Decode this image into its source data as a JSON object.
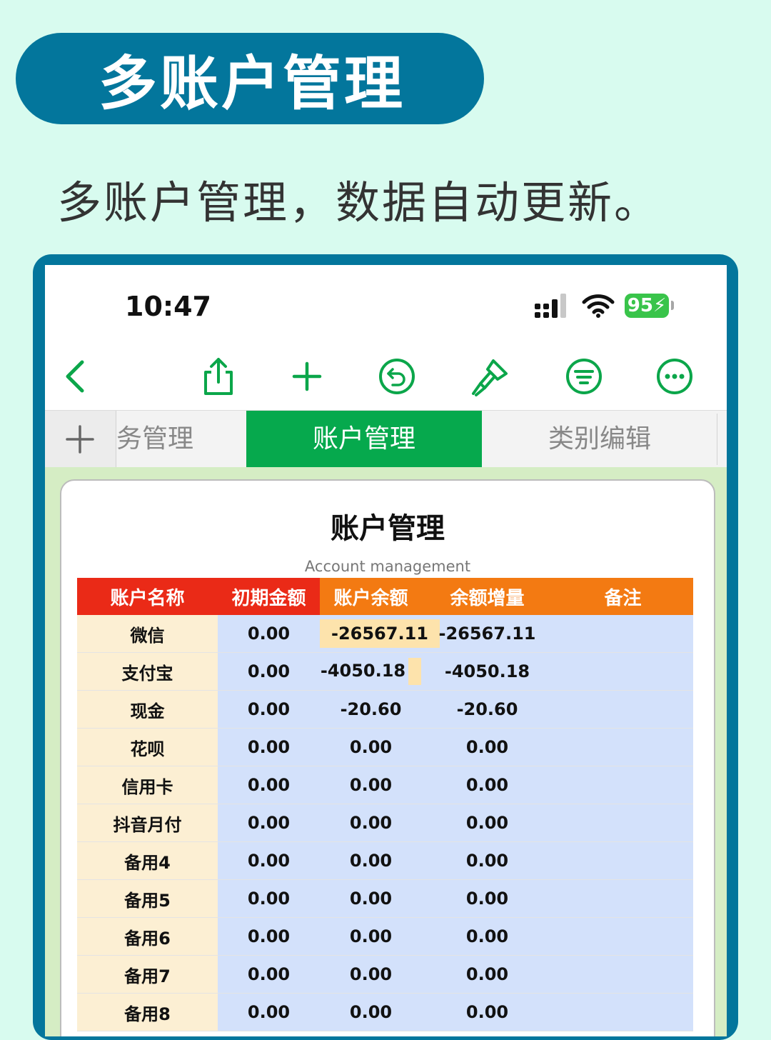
{
  "banner": {
    "title": "多账户管理"
  },
  "subtitle": "多账户管理，数据自动更新。",
  "status_bar": {
    "time": "10:47",
    "battery": "95"
  },
  "toolbar": {
    "icons": [
      "back-chevron-icon",
      "share-icon",
      "add-icon",
      "undo-icon",
      "format-brush-icon",
      "filter-icon",
      "more-icon"
    ]
  },
  "tabs": {
    "add_label": "+",
    "prev_partial": "务管理",
    "active": "账户管理",
    "next": "类别编辑"
  },
  "card": {
    "title": "账户管理",
    "subtitle": "Account management"
  },
  "table": {
    "headers": [
      "账户名称",
      "初期金额",
      "账户余额",
      "余额增量",
      "备注"
    ],
    "rows": [
      {
        "name": "微信",
        "initial": "0.00",
        "balance": "-26567.11",
        "delta": "-26567.11",
        "note": ""
      },
      {
        "name": "支付宝",
        "initial": "0.00",
        "balance": "-4050.18",
        "delta": "-4050.18",
        "note": ""
      },
      {
        "name": "现金",
        "initial": "0.00",
        "balance": "-20.60",
        "delta": "-20.60",
        "note": ""
      },
      {
        "name": "花呗",
        "initial": "0.00",
        "balance": "0.00",
        "delta": "0.00",
        "note": ""
      },
      {
        "name": "信用卡",
        "initial": "0.00",
        "balance": "0.00",
        "delta": "0.00",
        "note": ""
      },
      {
        "name": "抖音月付",
        "initial": "0.00",
        "balance": "0.00",
        "delta": "0.00",
        "note": ""
      },
      {
        "name": "备用4",
        "initial": "0.00",
        "balance": "0.00",
        "delta": "0.00",
        "note": ""
      },
      {
        "name": "备用5",
        "initial": "0.00",
        "balance": "0.00",
        "delta": "0.00",
        "note": ""
      },
      {
        "name": "备用6",
        "initial": "0.00",
        "balance": "0.00",
        "delta": "0.00",
        "note": ""
      },
      {
        "name": "备用7",
        "initial": "0.00",
        "balance": "0.00",
        "delta": "0.00",
        "note": ""
      },
      {
        "name": "备用8",
        "initial": "0.00",
        "balance": "0.00",
        "delta": "0.00",
        "note": ""
      }
    ]
  },
  "colors": {
    "page_bg": "#d8fbef",
    "brand": "#03769c",
    "accent_green": "#06a94d",
    "header_red": "#ea2a17",
    "header_orange": "#f37a12",
    "name_col": "#fcefd3",
    "value_col": "#d3e1fb",
    "highlight": "#fde3ac"
  }
}
